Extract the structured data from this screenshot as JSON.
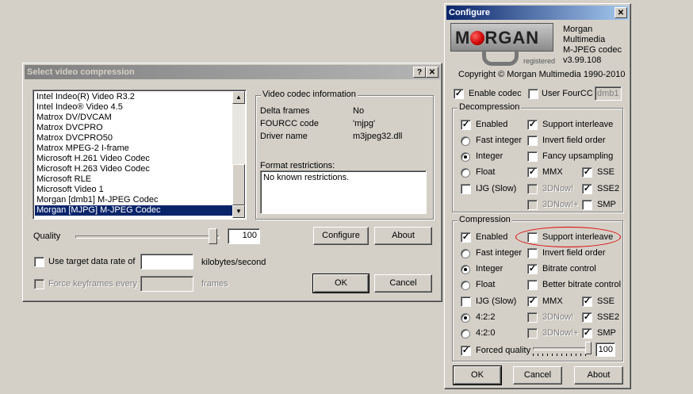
{
  "select_dialog": {
    "title": "Select video compression",
    "help_btn": "?",
    "close_btn": "✕",
    "codecs": [
      "Intel Indeo(R) Video R3.2",
      "Intel Indeo® Video 4.5",
      "Matrox DV/DVCAM",
      "Matrox DVCPRO",
      "Matrox DVCPRO50",
      "Matrox MPEG-2 I-frame",
      "Microsoft H.261 Video Codec",
      "Microsoft H.263 Video Codec",
      "Microsoft RLE",
      "Microsoft Video 1",
      "Morgan [dmb1] M-JPEG Codec",
      "Morgan [MJPG] M-JPEG Codec"
    ],
    "selected_codec": "Morgan [MJPG] M-JPEG Codec",
    "info_group": "Video codec information",
    "info_labels": {
      "delta": "Delta frames",
      "fourcc": "FOURCC code",
      "driver": "Driver name"
    },
    "info_values": {
      "delta": "No",
      "fourcc": "'mjpg'",
      "driver": "m3jpeg32.dll"
    },
    "format_label": "Format restrictions:",
    "format_text": "No known restrictions.",
    "quality_label": "Quality",
    "quality_value": "100",
    "configure_btn": "Configure",
    "about_btn": "About",
    "target_rate_label": "Use target data rate of",
    "target_rate_value": "",
    "target_rate_unit": "kilobytes/second",
    "keyframes_label": "Force keyframes every",
    "keyframes_unit": "frames",
    "ok_btn": "OK",
    "cancel_btn": "Cancel"
  },
  "configure_dialog": {
    "title": "Configure",
    "close_btn": "✕",
    "logo_text": "MORGAN",
    "logo_registered": "registered",
    "product_lines": [
      "Morgan",
      "Multimedia",
      "M-JPEG codec",
      "v3.99.108"
    ],
    "copyright": "Copyright © Morgan Multimedia 1990-2010",
    "enable_codec": "Enable codec",
    "user_fourcc": "User FourCC",
    "fourcc_value": "dmb1",
    "decompression": {
      "group": "Decompression",
      "enabled": "Enabled",
      "support_interleave": "Support interleave",
      "fast_integer": "Fast integer",
      "invert_field_order": "Invert field order",
      "integer": "Integer",
      "fancy_upsampling": "Fancy upsampling",
      "float": "Float",
      "mmx": "MMX",
      "sse": "SSE",
      "ijg": "IJG (Slow)",
      "now3d": "3DNow!",
      "sse2": "SSE2",
      "now3dplus": "3DNow!+",
      "smp": "SMP"
    },
    "compression": {
      "group": "Compression",
      "enabled": "Enabled",
      "support_interleave": "Support interleave",
      "fast_integer": "Fast integer",
      "invert_field_order": "Invert field order",
      "integer": "Integer",
      "bitrate_control": "Bitrate control",
      "float": "Float",
      "better_bitrate": "Better bitrate control",
      "ijg": "IJG (Slow)",
      "mmx": "MMX",
      "sse": "SSE",
      "s422": "4:2:2",
      "now3d": "3DNow!",
      "sse2": "SSE2",
      "s420": "4:2:0",
      "now3dplus": "3DNow!+",
      "smp": "SMP",
      "forced_quality": "Forced quality",
      "forced_quality_value": "100"
    },
    "ok_btn": "OK",
    "cancel_btn": "Cancel",
    "about_btn": "About"
  },
  "colors": {
    "selection": "#0a246a",
    "annotation_red": "#e00000",
    "logo_red": "#cc0000"
  }
}
